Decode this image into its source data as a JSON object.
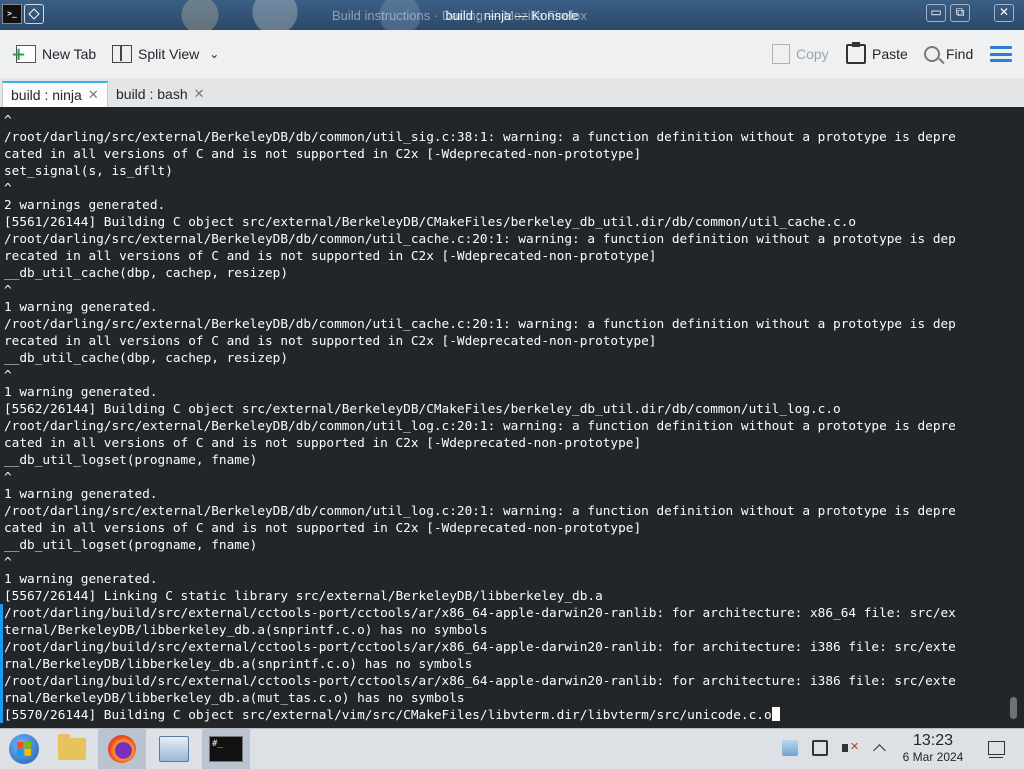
{
  "window": {
    "title": "build : ninja — Konsole",
    "background_title": "Build instructions · Darling — Mozilla Firefox",
    "controls": {
      "minimize": "▭",
      "maximize": "⧉",
      "close": "✕"
    }
  },
  "toolbar": {
    "new_tab": "New Tab",
    "split_view": "Split View",
    "copy": "Copy",
    "paste": "Paste",
    "find": "Find"
  },
  "tabs": [
    {
      "label": "build : ninja",
      "active": true
    },
    {
      "label": "build : bash",
      "active": false
    }
  ],
  "terminal": {
    "lines": [
      "^",
      "/root/darling/src/external/BerkeleyDB/db/common/util_sig.c:38:1: warning: a function definition without a prototype is depre",
      "cated in all versions of C and is not supported in C2x [-Wdeprecated-non-prototype]",
      "set_signal(s, is_dflt)",
      "^",
      "2 warnings generated.",
      "[5561/26144] Building C object src/external/BerkeleyDB/CMakeFiles/berkeley_db_util.dir/db/common/util_cache.c.o",
      "/root/darling/src/external/BerkeleyDB/db/common/util_cache.c:20:1: warning: a function definition without a prototype is dep",
      "recated in all versions of C and is not supported in C2x [-Wdeprecated-non-prototype]",
      "__db_util_cache(dbp, cachep, resizep)",
      "^",
      "1 warning generated.",
      "/root/darling/src/external/BerkeleyDB/db/common/util_cache.c:20:1: warning: a function definition without a prototype is dep",
      "recated in all versions of C and is not supported in C2x [-Wdeprecated-non-prototype]",
      "__db_util_cache(dbp, cachep, resizep)",
      "^",
      "1 warning generated.",
      "[5562/26144] Building C object src/external/BerkeleyDB/CMakeFiles/berkeley_db_util.dir/db/common/util_log.c.o",
      "/root/darling/src/external/BerkeleyDB/db/common/util_log.c:20:1: warning: a function definition without a prototype is depre",
      "cated in all versions of C and is not supported in C2x [-Wdeprecated-non-prototype]",
      "__db_util_logset(progname, fname)",
      "^",
      "1 warning generated.",
      "/root/darling/src/external/BerkeleyDB/db/common/util_log.c:20:1: warning: a function definition without a prototype is depre",
      "cated in all versions of C and is not supported in C2x [-Wdeprecated-non-prototype]",
      "__db_util_logset(progname, fname)",
      "^",
      "1 warning generated.",
      "[5567/26144] Linking C static library src/external/BerkeleyDB/libberkeley_db.a",
      "/root/darling/build/src/external/cctools-port/cctools/ar/x86_64-apple-darwin20-ranlib: for architecture: x86_64 file: src/ex",
      "ternal/BerkeleyDB/libberkeley_db.a(snprintf.c.o) has no symbols",
      "/root/darling/build/src/external/cctools-port/cctools/ar/x86_64-apple-darwin20-ranlib: for architecture: i386 file: src/exte",
      "rnal/BerkeleyDB/libberkeley_db.a(snprintf.c.o) has no symbols",
      "/root/darling/build/src/external/cctools-port/cctools/ar/x86_64-apple-darwin20-ranlib: for architecture: i386 file: src/exte",
      "rnal/BerkeleyDB/libberkeley_db.a(mut_tas.c.o) has no symbols"
    ],
    "last_line": "[5570/26144] Building C object src/external/vim/src/CMakeFiles/libvterm.dir/libvterm/src/unicode.c.o",
    "colors": {
      "background": "#232629",
      "foreground": "#fcfcfc",
      "marker": "#1d99f3"
    }
  },
  "taskbar": {
    "apps": [
      "start-menu-icon",
      "file-manager-icon",
      "firefox-icon",
      "system-settings-icon",
      "konsole-icon"
    ],
    "konsole_text": "#_",
    "clock": {
      "time": "13:23",
      "date": "6 Mar 2024"
    }
  }
}
